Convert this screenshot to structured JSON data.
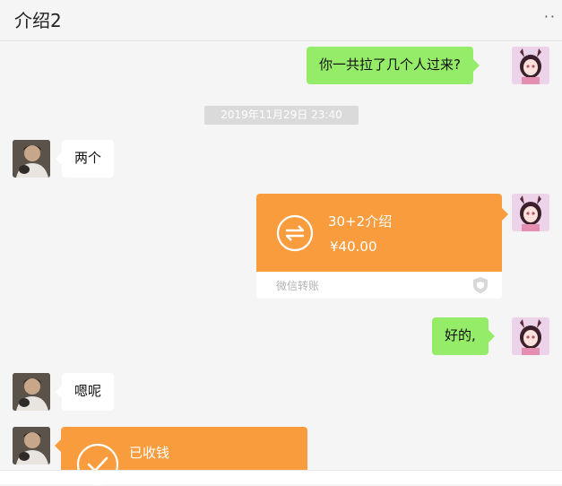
{
  "header": {
    "title": "介绍2",
    "more_icon": "more-dots-icon"
  },
  "messages": [
    {
      "side": "right",
      "type": "text",
      "text": "你一共拉了几个人过来?"
    },
    {
      "type": "time",
      "text": "2019年11月29日 23:40"
    },
    {
      "side": "left",
      "type": "text",
      "text": "两个"
    },
    {
      "side": "right",
      "type": "transfer",
      "title": "30+2介绍",
      "amount": "¥40.00",
      "footer": "微信转账"
    },
    {
      "side": "right",
      "type": "text",
      "text": "好的,"
    },
    {
      "side": "left",
      "type": "text",
      "text": "嗯呢"
    },
    {
      "side": "left",
      "type": "transfer-received",
      "title": "已收钱"
    }
  ],
  "colors": {
    "bubble_green": "#95ec69",
    "transfer_orange": "#f89c3d",
    "background": "#f5f5f5"
  }
}
